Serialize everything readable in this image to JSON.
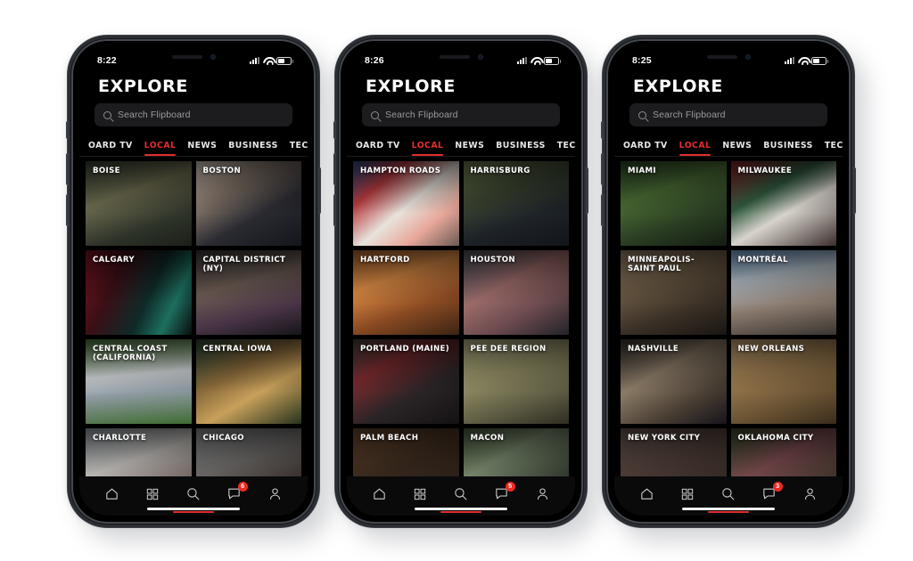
{
  "app": {
    "title": "EXPLORE",
    "search_placeholder": "Search Flipboard",
    "accent_color": "#e22d2d",
    "badge_color": "#ef2a21",
    "background": "#ffffff"
  },
  "tabs": [
    {
      "label": "OARD TV",
      "active": false
    },
    {
      "label": "LOCAL",
      "active": true
    },
    {
      "label": "NEWS",
      "active": false
    },
    {
      "label": "BUSINESS",
      "active": false
    },
    {
      "label": "TECH & SCIENC",
      "active": false
    }
  ],
  "nav": [
    {
      "name": "home",
      "icon": "home-icon",
      "active": false,
      "badge": ""
    },
    {
      "name": "grid",
      "icon": "grid-icon",
      "active": false,
      "badge": ""
    },
    {
      "name": "search",
      "icon": "search-icon",
      "active": true,
      "badge": ""
    },
    {
      "name": "notifications",
      "icon": "chat-bubble-icon",
      "active": false,
      "badge": "6"
    },
    {
      "name": "profile",
      "icon": "person-icon",
      "active": false,
      "badge": ""
    }
  ],
  "phones": [
    {
      "id": "phone-1",
      "status": {
        "time": "8:22",
        "signal": "signal-icon",
        "wifi": "wifi-icon",
        "battery": "battery-icon"
      },
      "badge": "6",
      "tiles": [
        {
          "label": "BOISE",
          "art": "linear-gradient(160deg,#3a4434 0%,#6b6a4e 38%,#2e3329 72%,#1b1f18 100%)"
        },
        {
          "label": "BOSTON",
          "art": "linear-gradient(150deg,#d8cdc2 0%,#8a7a6d 30%,#2a2a31 62%,#14161c 100%)"
        },
        {
          "label": "CALGARY",
          "art": "linear-gradient(115deg,#7a1420 0%,#3a0f16 30%,#0e2a28 58%,#1d6f5e 78%,#0a0c0e 100%)"
        },
        {
          "label": "CAPITAL DISTRICT (NY)",
          "art": "linear-gradient(165deg,#3d3a38 0%,#6b5b52 40%,#4a3547 70%,#16151a 100%)"
        },
        {
          "label": "CENTRAL COAST (CALIFORNIA)",
          "art": "linear-gradient(175deg,#4f7c3c 0%,#cfd3d6 42%,#8f9aa2 62%,#3f6b32 100%)"
        },
        {
          "label": "CENTRAL IOWA",
          "art": "linear-gradient(150deg,#2e4a36 0%,#8a6a3a 38%,#c7a05a 62%,#27331f 100%)"
        },
        {
          "label": "CHARLOTTE",
          "art": "linear-gradient(160deg,#9aa3ab 0%,#c3bfbb 40%,#7a6b68 70%,#3a3436 100%)"
        },
        {
          "label": "CHICAGO",
          "art": "linear-gradient(160deg,#8e9093 0%,#6d6a68 40%,#3a2f2c 72%,#191516 100%)"
        }
      ]
    },
    {
      "id": "phone-2",
      "status": {
        "time": "8:26",
        "signal": "signal-icon",
        "wifi": "wifi-icon",
        "battery": "battery-icon"
      },
      "badge": "5",
      "tiles": [
        {
          "label": "HAMPTON ROADS",
          "art": "linear-gradient(140deg,#2b4a86 0%,#b83b3f 26%,#e7e3dc 52%,#e8a79a 74%,#6b5a52 100%)"
        },
        {
          "label": "HARRISBURG",
          "art": "linear-gradient(160deg,#6f7c4e 0%,#3b4430 35%,#1e2328 65%,#12151a 100%)"
        },
        {
          "label": "HARTFORD",
          "art": "linear-gradient(160deg,#b36a33 0%,#d98a44 34%,#8a4a22 66%,#3a2414 100%)"
        },
        {
          "label": "HOUSTON",
          "art": "linear-gradient(150deg,#4a4f58 0%,#9a6a68 40%,#6b4a4e 68%,#222329 100%)"
        },
        {
          "label": "PORTLAND (MAINE)",
          "art": "linear-gradient(150deg,#4a4440 0%,#7a2a2e 30%,#2a2426 62%,#141213 100%)"
        },
        {
          "label": "PEE DEE REGION",
          "art": "linear-gradient(160deg,#b8b488 0%,#8e8a62 40%,#5f5d44 70%,#2e2d22 100%)"
        },
        {
          "label": "PALM BEACH",
          "art": "linear-gradient(160deg,#6b4a30 0%,#3a2a1e 45%,#1e1714 100%)"
        },
        {
          "label": "MACON",
          "art": "linear-gradient(150deg,#4a5b3e 0%,#7a8a6e 35%,#3a4236 70%,#171a16 100%)"
        }
      ]
    },
    {
      "id": "phone-3",
      "status": {
        "time": "8:25",
        "signal": "signal-icon",
        "wifi": "wifi-icon",
        "battery": "battery-icon"
      },
      "badge": "3",
      "tiles": [
        {
          "label": "MIAMI",
          "art": "linear-gradient(160deg,#2e4a28 0%,#4a6b34 35%,#2a3d22 68%,#141c12 100%)"
        },
        {
          "label": "MILWAUKEE",
          "art": "linear-gradient(150deg,#8a1f28 0%,#2f5a3e 35%,#d8d3cc 58%,#3a2e2c 100%)"
        },
        {
          "label": "MINNEAPOLIS-SAINT PAUL",
          "art": "linear-gradient(160deg,#9a8468 0%,#6b5a44 35%,#3a3026 68%,#1a1612 100%)"
        },
        {
          "label": "MONTRÉAL",
          "art": "linear-gradient(170deg,#7aa8d8 0%,#b8c4cc 30%,#8a7a6e 62%,#3a3530 100%)"
        },
        {
          "label": "NASHVILLE",
          "art": "linear-gradient(150deg,#3a3530 0%,#8a7a66 38%,#4a3f34 70%,#17141a 100%)"
        },
        {
          "label": "NEW ORLEANS",
          "art": "linear-gradient(160deg,#c9a878 0%,#9a7a4e 35%,#6b5434 68%,#3a2c1c 100%)"
        },
        {
          "label": "NEW YORK CITY",
          "art": "linear-gradient(160deg,#6b5a52 0%,#4a3a34 45%,#241c1a 100%)"
        },
        {
          "label": "OKLAHOMA CITY",
          "art": "linear-gradient(150deg,#3a4a2e 0%,#7a4a4e 40%,#4a3a32 70%,#1c1815 100%)"
        }
      ]
    }
  ]
}
